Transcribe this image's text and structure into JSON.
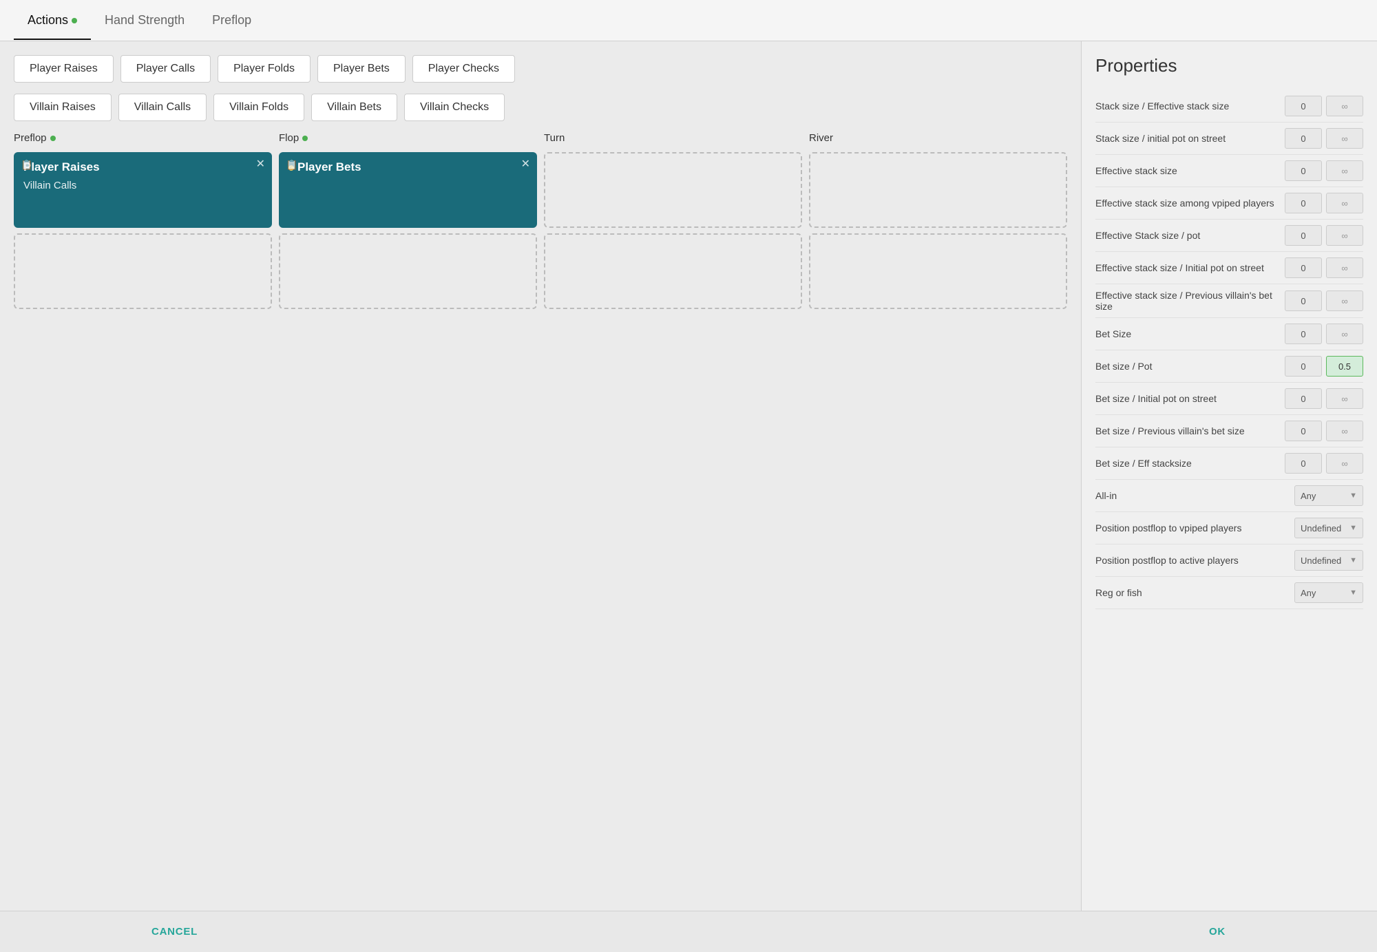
{
  "tabs": [
    {
      "label": "Actions",
      "active": true,
      "dot": true
    },
    {
      "label": "Hand Strength",
      "active": false,
      "dot": false
    },
    {
      "label": "Preflop",
      "active": false,
      "dot": false
    }
  ],
  "action_buttons_row1": [
    "Player Raises",
    "Player Calls",
    "Player Folds",
    "Player Bets",
    "Player Checks"
  ],
  "action_buttons_row2": [
    "Villain Raises",
    "Villain Calls",
    "Villain Folds",
    "Villain Bets",
    "Villain Checks"
  ],
  "streets": [
    {
      "label": "Preflop",
      "dot": true,
      "cards": [
        {
          "type": "filled",
          "title": "Player Raises",
          "subtitle": "Villain Calls",
          "indicator": false
        },
        {
          "type": "empty"
        }
      ]
    },
    {
      "label": "Flop",
      "dot": true,
      "cards": [
        {
          "type": "filled",
          "title": "Player Bets",
          "subtitle": null,
          "indicator": true
        },
        {
          "type": "empty"
        }
      ]
    },
    {
      "label": "Turn",
      "dot": false,
      "cards": [
        {
          "type": "empty"
        },
        {
          "type": "empty"
        }
      ]
    },
    {
      "label": "River",
      "dot": false,
      "cards": [
        {
          "type": "empty"
        },
        {
          "type": "empty"
        }
      ]
    }
  ],
  "properties": {
    "title": "Properties",
    "rows": [
      {
        "label": "Stack size / Effective stack size",
        "val1": "0",
        "val2": "∞"
      },
      {
        "label": "Stack size / initial pot on street",
        "val1": "0",
        "val2": "∞"
      },
      {
        "label": "Effective stack size",
        "val1": "0",
        "val2": "∞"
      },
      {
        "label": "Effective stack size among vpiped players",
        "val1": "0",
        "val2": "∞"
      },
      {
        "label": "Effective Stack size / pot",
        "val1": "0",
        "val2": "∞"
      },
      {
        "label": "Effective stack size / Initial pot on street",
        "val1": "0",
        "val2": "∞"
      },
      {
        "label": "Effective stack size / Previous villain's bet size",
        "val1": "0",
        "val2": "∞"
      },
      {
        "label": "Bet Size",
        "val1": "0",
        "val2": "∞"
      },
      {
        "label": "Bet size / Pot",
        "val1": "0",
        "val2": "0.5",
        "highlighted": true
      },
      {
        "label": "Bet size / Initial pot on street",
        "val1": "0",
        "val2": "∞"
      },
      {
        "label": "Bet size / Previous villain's bet size",
        "val1": "0",
        "val2": "∞"
      },
      {
        "label": "Bet size / Eff stacksize",
        "val1": "0",
        "val2": "∞"
      },
      {
        "label": "All-in",
        "select": "Any"
      },
      {
        "label": "Position postflop to vpiped players",
        "select": "Undefined"
      },
      {
        "label": "Position postflop to active players",
        "select": "Undefined"
      },
      {
        "label": "Reg or fish",
        "select": "Any"
      }
    ]
  },
  "footer": {
    "cancel_label": "CANCEL",
    "ok_label": "OK"
  }
}
